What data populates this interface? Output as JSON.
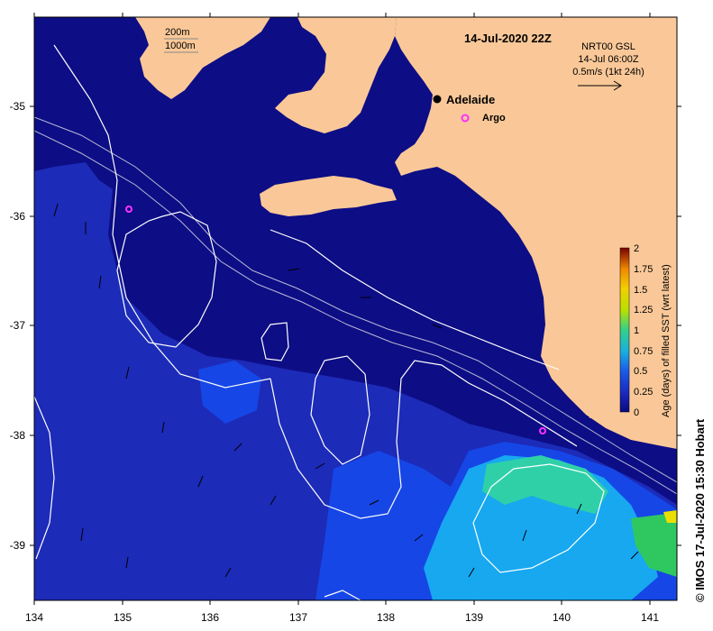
{
  "title": "14-Jul-2020 22Z",
  "product": {
    "line1": "NRT00 GSL",
    "line2": "14-Jul 06:00Z",
    "line3": "0.5m/s (1kt 24h)"
  },
  "isobath_legend": [
    "200m",
    "1000m"
  ],
  "places": {
    "city": "Adelaide",
    "float": "Argo"
  },
  "axes": {
    "x_ticks": [
      "134",
      "135",
      "136",
      "137",
      "138",
      "139",
      "140",
      "141"
    ],
    "y_ticks": [
      "-35",
      "-36",
      "-37",
      "-38",
      "-39"
    ]
  },
  "colorbar": {
    "label": "Age (days) of filled SST (wrt latest)",
    "ticks": [
      "2",
      "1.75",
      "1.5",
      "1.25",
      "1",
      "0.75",
      "0.5",
      "0.25",
      "0"
    ],
    "colors": [
      "#7a0000",
      "#c81e00",
      "#f08a00",
      "#f2d000",
      "#b8e000",
      "#33d08a",
      "#18b0e0",
      "#1a5ce8",
      "#1a1aa8",
      "#0a0a80"
    ]
  },
  "credit": "© IMOS 17-Jul-2020 15:30 Hobart",
  "colors": {
    "ocean_deep": "#0d0d85",
    "ocean_mid": "#1c2bb8",
    "ocean_blue": "#1646e6",
    "ocean_light": "#17a8f0",
    "ocean_green": "#2fd0a8",
    "land": "#fac898",
    "argo": "#ff30ff"
  }
}
